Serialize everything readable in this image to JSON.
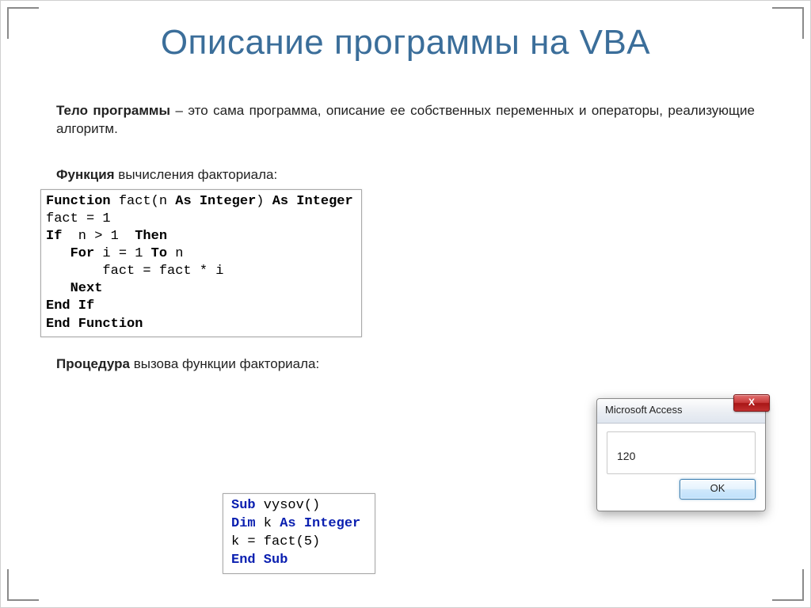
{
  "title": "Описание программы на VBA",
  "paragraph": {
    "bold": "Тело программы",
    "rest": " – это сама программа, описание ее собственных переменных и операторы, реализующие алгоритм."
  },
  "func_heading": {
    "bold": "Функция",
    "rest": " вычисления факториала:"
  },
  "proc_heading": {
    "bold": "Процедура",
    "rest": " вызова функции факториала:"
  },
  "function_code": {
    "l1_a": "Function",
    "l1_b": " fact(n ",
    "l1_c": "As Integer",
    "l1_d": ") ",
    "l1_e": "As Integer",
    "l2": "fact = 1",
    "l3_a": "If",
    "l3_b": "  n > 1  ",
    "l3_c": "Then",
    "l4_a": "   For",
    "l4_b": " i = 1 ",
    "l4_c": "To",
    "l4_d": " n",
    "l5": "       fact = fact * i",
    "l6": "   Next",
    "l7": "End If",
    "l8": "End Function"
  },
  "sub_code": {
    "l1_a": "Sub",
    "l1_b": " vysov()",
    "l2_a": "Dim",
    "l2_b": " k ",
    "l2_c": "As Integer",
    "l3": "k = fact(5)",
    "l4": "End Sub"
  },
  "dialog": {
    "title": "Microsoft Access",
    "close_label": "X",
    "value": "120",
    "ok": "OK"
  }
}
